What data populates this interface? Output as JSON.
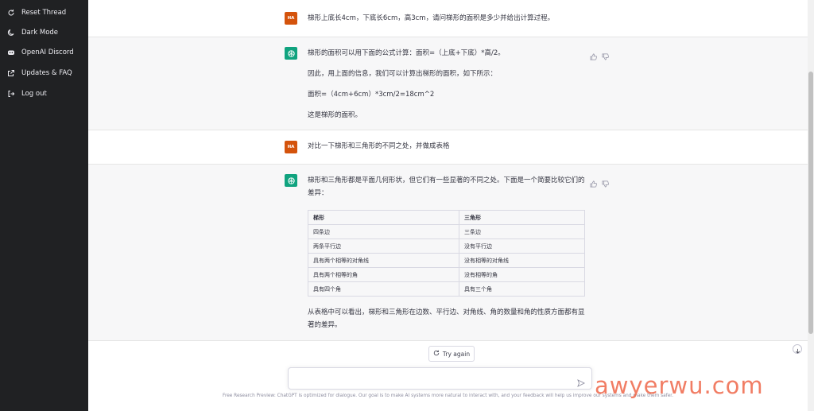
{
  "sidebar": {
    "items": [
      {
        "label": "Reset Thread",
        "icon": "reset-icon"
      },
      {
        "label": "Dark Mode",
        "icon": "moon-icon"
      },
      {
        "label": "OpenAI Discord",
        "icon": "discord-icon"
      },
      {
        "label": "Updates & FAQ",
        "icon": "external-link-icon"
      },
      {
        "label": "Log out",
        "icon": "logout-icon"
      }
    ]
  },
  "conversation": {
    "user_avatar": "HA",
    "msg1": {
      "text": "梯形上底长4cm，下底长6cm，高3cm，请问梯形的面积是多少并给出计算过程。"
    },
    "reply1": {
      "p1": "梯形的面积可以用下面的公式计算：面积=（上底+下底）*高/2。",
      "p2": "因此，用上面的信息，我们可以计算出梯形的面积，如下所示：",
      "p3": "面积=（4cm+6cm）*3cm/2=18cm^2",
      "p4": "这是梯形的面积。"
    },
    "msg2": {
      "text": "对比一下梯形和三角形的不同之处，并做成表格"
    },
    "reply2": {
      "intro": "梯形和三角形都是平面几何形状，但它们有一些显著的不同之处。下面是一个简要比较它们的差异：",
      "table": {
        "headers": [
          "梯形",
          "三角形"
        ],
        "rows": [
          [
            "四条边",
            "三条边"
          ],
          [
            "两条平行边",
            "没有平行边"
          ],
          [
            "具有两个相等的对角线",
            "没有相等的对角线"
          ],
          [
            "具有两个相等的角",
            "没有相等的角"
          ],
          [
            "具有四个角",
            "具有三个角"
          ]
        ]
      },
      "outro": "从表格中可以看出，梯形和三角形在边数、平行边、对角线、角的数量和角的性质方面都有显著的差异。"
    }
  },
  "try_again_label": "Try again",
  "composer": {
    "value": ""
  },
  "footer": "Free Research Preview: ChatGPT is optimized for dialogue. Our goal is to make AI systems more natural to interact with, and your feedback will help us improve our systems and make them safer.",
  "watermark": "awyerwu.com",
  "colors": {
    "sidebar_bg": "#202123",
    "bot_bg": "#f7f7f8",
    "gpt_green": "#10a37f",
    "user_avatar": "#d4530c"
  }
}
